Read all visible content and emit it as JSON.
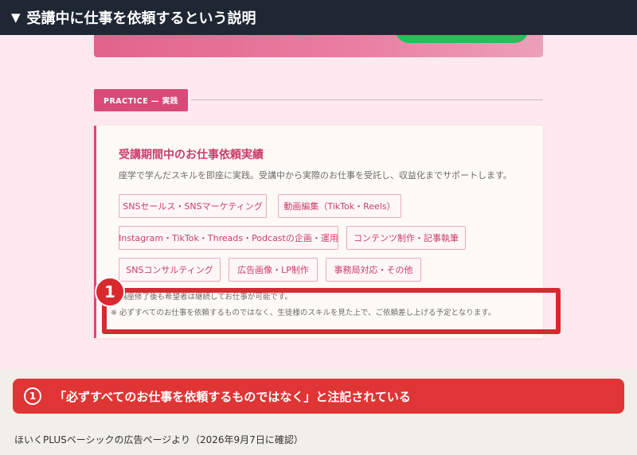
{
  "header": {
    "title": "受講中に仕事を依頼するという説明",
    "toggle_icon": "triangle-down-icon"
  },
  "section": {
    "badge": "PRACTICE — 実践"
  },
  "card": {
    "title": "受講期間中のお仕事依頼実績",
    "description": "座学で学んだスキルを即座に実践。受講中から実際のお仕事を受託し、収益化までサポートします。",
    "tags": [
      "SNSセールス・SNSマーケティング",
      "動画編集（TikTok・Reels）",
      "Instagram・TikTok・Threads・Podcastの企画・運用",
      "コンテンツ制作・記事執筆",
      "SNSコンサルティング",
      "広告画像・LP制作",
      "事務局対応・その他"
    ],
    "notes": [
      "※ 講座修了後も希望者は継続してお仕事が可能です。",
      "※ 必ずすべてのお仕事を依頼するものではなく、生徒様のスキルを見た上で、ご依頼差し上げる予定となります。"
    ]
  },
  "annotation": {
    "marker": "1",
    "callout_number": "1",
    "callout_text": "「必ずすべてのお仕事を依頼するものではなく」と注記されている"
  },
  "source": "ほいくPLUSベーシックの広告ページより（2026年9月7日に確認）",
  "colors": {
    "accent": "#d94a78",
    "highlight": "#d8292f",
    "topbar": "#1f2733"
  }
}
